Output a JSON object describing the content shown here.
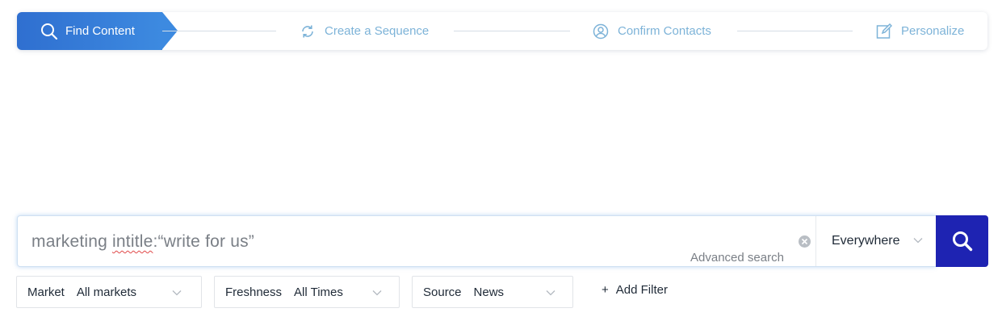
{
  "stepper": {
    "steps": [
      {
        "label": "Find Content",
        "icon": "search-icon",
        "active": true
      },
      {
        "label": "Create a Sequence",
        "icon": "refresh-icon",
        "active": false
      },
      {
        "label": "Confirm Contacts",
        "icon": "user-circle-icon",
        "active": false
      },
      {
        "label": "Personalize",
        "icon": "edit-icon",
        "active": false
      }
    ]
  },
  "search": {
    "query_part1": "marketing ",
    "query_misspelled": "intitle",
    "query_part2": ":“write for us”",
    "advanced_label": "Advanced search",
    "scope_value": "Everywhere"
  },
  "filters": [
    {
      "label": "Market",
      "value": "All markets"
    },
    {
      "label": "Freshness",
      "value": "All Times"
    },
    {
      "label": "Source",
      "value": "News"
    }
  ],
  "add_filter": {
    "plus": "+",
    "label": "Add Filter"
  },
  "colors": {
    "active_step": "#2f6fd0",
    "inactive_step": "#7db3d8",
    "search_button": "#1e23b2"
  }
}
